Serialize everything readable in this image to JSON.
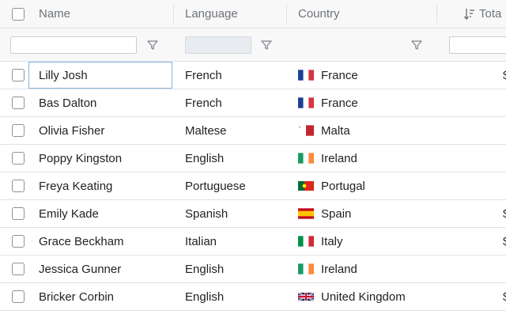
{
  "columns": {
    "name": "Name",
    "language": "Language",
    "country": "Country",
    "total": "Tota"
  },
  "filters": {
    "name_value": "",
    "language_value": "",
    "total_value": ""
  },
  "rows": [
    {
      "name": "Lilly Josh",
      "language": "French",
      "country": "France",
      "flag": "france-flag-icon",
      "total": "$",
      "selected": true
    },
    {
      "name": "Bas Dalton",
      "language": "French",
      "country": "France",
      "flag": "france-flag-icon",
      "total": ""
    },
    {
      "name": "Olivia Fisher",
      "language": "Maltese",
      "country": "Malta",
      "flag": "malta-flag-icon",
      "total": ""
    },
    {
      "name": "Poppy Kingston",
      "language": "English",
      "country": "Ireland",
      "flag": "ireland-flag-icon",
      "total": ""
    },
    {
      "name": "Freya Keating",
      "language": "Portuguese",
      "country": "Portugal",
      "flag": "portugal-flag-icon",
      "total": ""
    },
    {
      "name": "Emily Kade",
      "language": "Spanish",
      "country": "Spain",
      "flag": "spain-flag-icon",
      "total": "$"
    },
    {
      "name": "Grace Beckham",
      "language": "Italian",
      "country": "Italy",
      "flag": "italy-flag-icon",
      "total": "$"
    },
    {
      "name": "Jessica Gunner",
      "language": "English",
      "country": "Ireland",
      "flag": "ireland-flag-icon",
      "total": ""
    },
    {
      "name": "Bricker Corbin",
      "language": "English",
      "country": "United Kingdom",
      "flag": "uk-flag-icon",
      "total": "$"
    }
  ],
  "colors": {
    "border": "#dde2eb",
    "header_bg": "#f8f8f8",
    "selection_outline": "#8bb4de"
  }
}
